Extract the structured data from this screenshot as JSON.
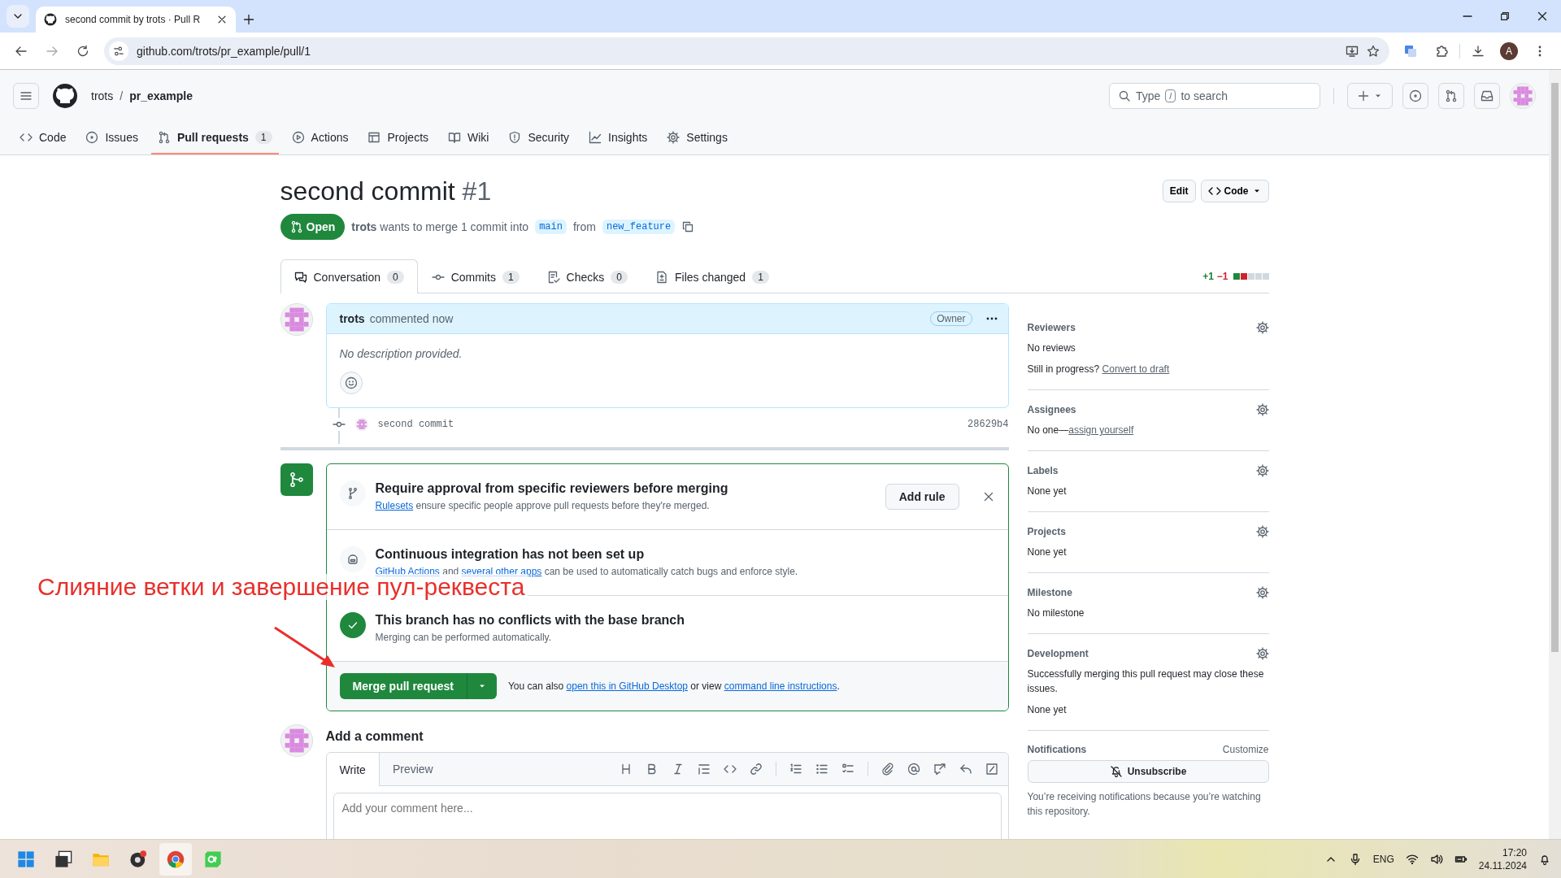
{
  "browser": {
    "tab_title": "second commit by trots · Pull R",
    "url": "github.com/trots/pr_example/pull/1",
    "profile_initial": "A"
  },
  "header": {
    "owner": "trots",
    "separator": "/",
    "repo": "pr_example",
    "search": {
      "before": "Type",
      "key": "/",
      "after": "to search"
    }
  },
  "repo_nav": [
    {
      "label": "Code",
      "kind": "code",
      "selected": false
    },
    {
      "label": "Issues",
      "kind": "issues",
      "selected": false
    },
    {
      "label": "Pull requests",
      "kind": "pulls",
      "count": "1",
      "selected": true
    },
    {
      "label": "Actions",
      "kind": "actions",
      "selected": false
    },
    {
      "label": "Projects",
      "kind": "projects",
      "selected": false
    },
    {
      "label": "Wiki",
      "kind": "wiki",
      "selected": false
    },
    {
      "label": "Security",
      "kind": "security",
      "selected": false
    },
    {
      "label": "Insights",
      "kind": "insights",
      "selected": false
    },
    {
      "label": "Settings",
      "kind": "settings",
      "selected": false
    }
  ],
  "pull_request": {
    "title": "second commit",
    "number": "#1",
    "state": "Open",
    "author": "trots",
    "merge_text": "wants to merge 1 commit into",
    "base": "main",
    "from_text": "from",
    "head": "new_feature",
    "edit_button": "Edit",
    "code_button": "Code"
  },
  "pr_tabs": [
    {
      "label": "Conversation",
      "kind": "conversation",
      "count": "0",
      "selected": true
    },
    {
      "label": "Commits",
      "kind": "commits",
      "count": "1",
      "selected": false
    },
    {
      "label": "Checks",
      "kind": "checks",
      "count": "0",
      "selected": false
    },
    {
      "label": "Files changed",
      "kind": "files",
      "count": "1",
      "selected": false
    }
  ],
  "diffstat": {
    "additions": "+1",
    "deletions": "−1",
    "blocks": [
      {
        "color": "#1f883d"
      },
      {
        "color": "#cf222e"
      },
      {
        "color": "#d1d9e0"
      },
      {
        "color": "#d1d9e0"
      },
      {
        "color": "#d1d9e0"
      }
    ]
  },
  "comment": {
    "author": "trots",
    "action": "commented now",
    "badge": "Owner",
    "body": "No description provided."
  },
  "commits": [
    {
      "message": "second commit",
      "sha": "28629b4"
    }
  ],
  "merge_box": {
    "sections": [
      {
        "kind": "rule",
        "title": "Require approval from specific reviewers before merging",
        "parts": [
          {
            "text": "Rulesets",
            "link": true
          },
          {
            "text": " ensure specific people approve pull requests before they're merged.",
            "link": false
          }
        ],
        "button": "Add rule"
      },
      {
        "kind": "ci",
        "title": "Continuous integration has not been set up",
        "parts": [
          {
            "text": "GitHub Actions",
            "link": true
          },
          {
            "text": " and ",
            "link": false
          },
          {
            "text": "several other apps",
            "link": true
          },
          {
            "text": " can be used to automatically catch bugs and enforce style.",
            "link": false
          }
        ]
      },
      {
        "kind": "status",
        "title": "This branch has no conflicts with the base branch",
        "parts": [
          {
            "text": "Merging can be performed automatically.",
            "link": false
          }
        ]
      }
    ],
    "merge_button": "Merge pull request",
    "alternatives": [
      {
        "text": "You can also ",
        "link": false
      },
      {
        "text": "open this in GitHub Desktop",
        "link": true
      },
      {
        "text": " or view ",
        "link": false
      },
      {
        "text": "command line instructions",
        "link": true
      },
      {
        "text": ".",
        "link": false
      }
    ]
  },
  "add_comment": {
    "title": "Add a comment",
    "tabs": [
      {
        "label": "Write",
        "selected": true
      },
      {
        "label": "Preview",
        "selected": false
      }
    ],
    "placeholder": "Add your comment here..."
  },
  "sidebar": [
    {
      "title": "Reviewers",
      "lines": [
        [
          {
            "text": "No reviews",
            "link": false
          }
        ],
        [
          {
            "text": "Still in progress? ",
            "link": false
          },
          {
            "text": "Convert to draft",
            "link": true
          }
        ]
      ]
    },
    {
      "title": "Assignees",
      "lines": [
        [
          {
            "text": "No one—",
            "link": false
          },
          {
            "text": "assign yourself",
            "link": true
          }
        ]
      ]
    },
    {
      "title": "Labels",
      "lines": [
        [
          {
            "text": "None yet",
            "link": false
          }
        ]
      ]
    },
    {
      "title": "Projects",
      "lines": [
        [
          {
            "text": "None yet",
            "link": false
          }
        ]
      ]
    },
    {
      "title": "Milestone",
      "lines": [
        [
          {
            "text": "No milestone",
            "link": false
          }
        ]
      ]
    },
    {
      "title": "Development",
      "lines": [
        [
          {
            "text": "Successfully merging this pull request may close these issues.",
            "link": false
          }
        ],
        [
          {
            "text": "None yet",
            "link": false
          }
        ]
      ]
    }
  ],
  "notifications": {
    "title": "Notifications",
    "customize": "Customize",
    "button": "Unsubscribe",
    "text": "You’re receiving notifications because you’re watching this repository."
  },
  "annotation": {
    "text": "Слияние ветки и завершение пул-реквеста"
  },
  "taskbar": {
    "language": "ENG",
    "time": "17:20",
    "date": "24.11.2024"
  }
}
